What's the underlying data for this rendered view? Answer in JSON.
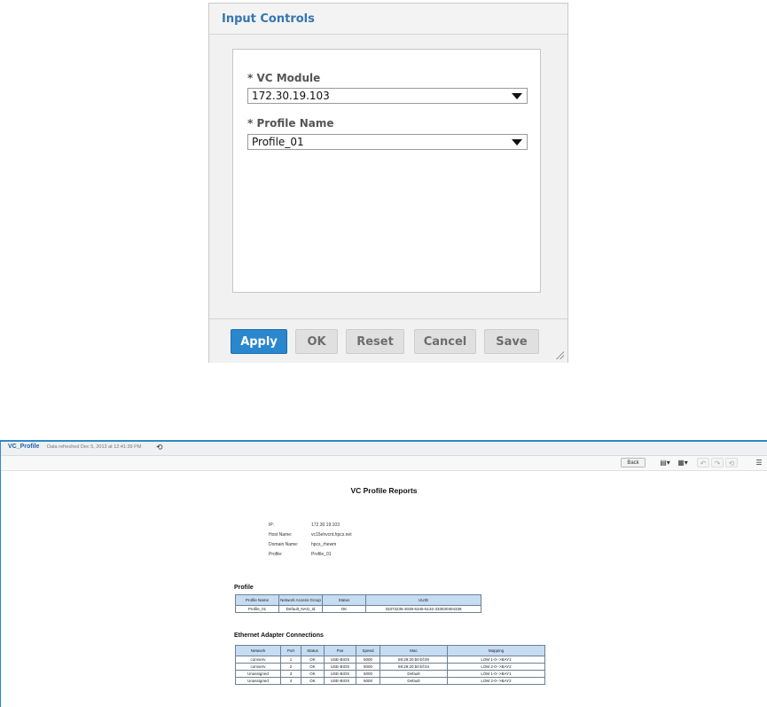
{
  "dialog": {
    "title": "Input Controls",
    "fields": [
      {
        "label": "* VC Module",
        "value": "172.30.19.103"
      },
      {
        "label": "* Profile Name",
        "value": "Profile_01"
      }
    ],
    "buttons": {
      "apply": "Apply",
      "ok": "OK",
      "reset": "Reset",
      "cancel": "Cancel",
      "save": "Save"
    }
  },
  "viewer": {
    "report_name": "VC_Profile",
    "refresh_text": "Data refreshed Dec 5, 2013 at 12:41:39 PM",
    "back_label": "Back",
    "title": "VC Profile Reports",
    "info": [
      {
        "label": "IP:",
        "value": "172.30.19.103"
      },
      {
        "label": "Host Name:",
        "value": "vc15ehvcnt.hpcs.net"
      },
      {
        "label": "Domain Name:",
        "value": "hpcs_rhewm"
      },
      {
        "label": "Profile:",
        "value": "Profile_01"
      }
    ],
    "profile_section": {
      "title": "Profile",
      "headers": [
        "Profile Name",
        "Network Access Group",
        "Status",
        "UUID"
      ],
      "rows": [
        [
          "Profile_01",
          "Default_NAG_Id",
          "OK",
          "33373235-3038-5345-5132-333530304338"
        ]
      ]
    },
    "ethernet_section": {
      "title": "Ethernet Adapter Connections",
      "headers": [
        "Network",
        "Port",
        "Status",
        "Pxe",
        "Speed",
        "Mac",
        "Mapping"
      ],
      "rows": [
        [
          "comserv",
          "1",
          "OK",
          "USE-BIOS",
          "5000",
          "69:29:20:b0:bf:00",
          "LOM 1-0-->BAY1"
        ],
        [
          "comserv",
          "2",
          "OK",
          "USE-BIOS",
          "5000",
          "69:29:20:b0:bf:04",
          "LOM 2-0-->BAY2"
        ],
        [
          "Unassigned",
          "3",
          "OK",
          "USE-BIOS",
          "5000",
          "Default",
          "LOM 1-0-->BAY1"
        ],
        [
          "Unassigned",
          "4",
          "OK",
          "USE-BIOS",
          "5000",
          "Default",
          "LOM 2-0-->BAY2"
        ]
      ]
    }
  }
}
